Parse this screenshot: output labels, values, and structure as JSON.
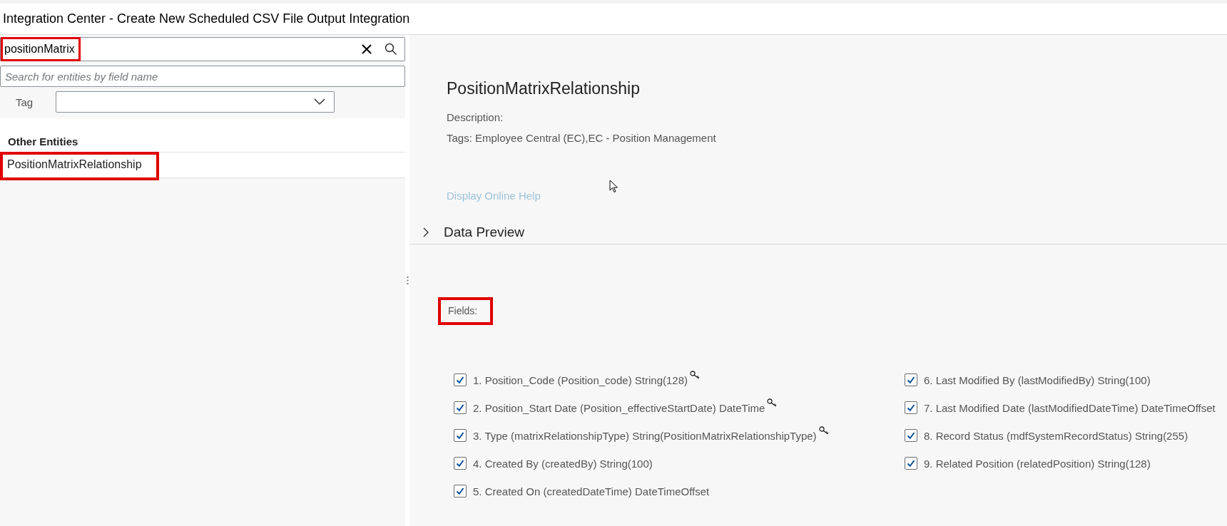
{
  "window": {
    "title": "Integration Center - Create New Scheduled CSV File Output Integration"
  },
  "sidebar": {
    "search": {
      "value": "positionMatrix",
      "highlighted": true
    },
    "field_search": {
      "placeholder": "Search for entities by field name"
    },
    "tag_filter": {
      "label": "Tag"
    },
    "group_title": "Other Entities",
    "items": [
      {
        "label": "PositionMatrixRelationship",
        "selected": false,
        "highlighted": true
      }
    ]
  },
  "detail": {
    "title": "PositionMatrixRelationship",
    "description": "Description:",
    "tags": "Tags: Employee Central (EC),EC - Position Management",
    "help_link": "Display Online Help",
    "data_preview": {
      "label": "Data Preview",
      "expanded": false
    },
    "fields_label": {
      "text": "Fields:",
      "highlighted": true
    },
    "fields": [
      {
        "label": "1. Position_Code (Position_code) String(128)",
        "checked": true,
        "key": true
      },
      {
        "label": "2. Position_Start Date (Position_effectiveStartDate) DateTime",
        "checked": true,
        "key": true
      },
      {
        "label": "3. Type (matrixRelationshipType) String(PositionMatrixRelationshipType)",
        "checked": true,
        "key": true
      },
      {
        "label": "4. Created By (createdBy) String(100)",
        "checked": true,
        "key": false
      },
      {
        "label": "5. Created On (createdDateTime) DateTimeOffset",
        "checked": true,
        "key": false
      },
      {
        "label": "6. Last Modified By (lastModifiedBy) String(100)",
        "checked": true,
        "key": false
      },
      {
        "label": "7. Last Modified Date (lastModifiedDateTime) DateTimeOffset",
        "checked": true,
        "key": false
      },
      {
        "label": "8. Record Status (mdfSystemRecordStatus) String(255)",
        "checked": true,
        "key": false
      },
      {
        "label": "9. Related Position (relatedPosition) String(128)",
        "checked": true,
        "key": false
      }
    ]
  }
}
